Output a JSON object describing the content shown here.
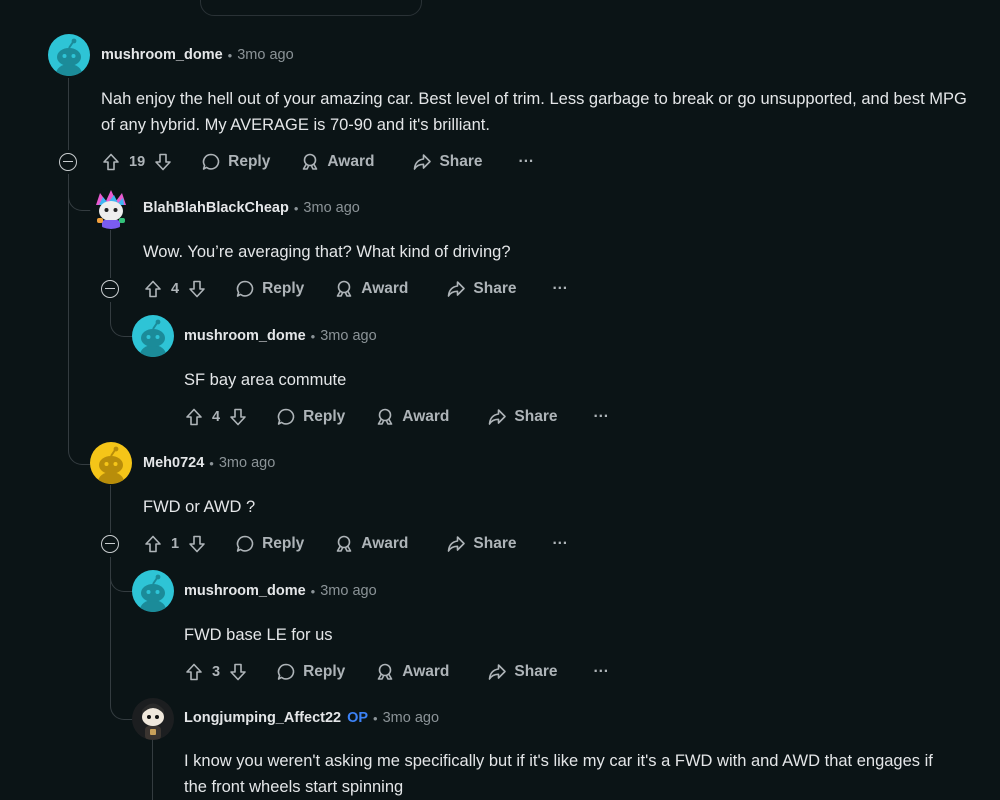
{
  "labels": {
    "reply": "Reply",
    "award": "Award",
    "share": "Share",
    "more": "···",
    "op_badge": "OP"
  },
  "colors": {
    "background": "#0b1416",
    "op_badge": "#3c82f6",
    "avatar_teal": "#2ec4d6",
    "avatar_yellow": "#f5c518"
  },
  "comments": [
    {
      "author": "mushroom_dome",
      "time": "3mo ago",
      "score": "19",
      "body": "Nah enjoy the hell out of your amazing car. Best level of trim. Less garbage to break or go unsupported, and best MPG of any hybrid. My AVERAGE is 70-90 and it's brilliant.",
      "avatar": "teal-snoo-avatar"
    },
    {
      "author": "BlahBlahBlackCheap",
      "time": "3mo ago",
      "score": "4",
      "body": "Wow. You’re averaging that? What kind of driving?",
      "avatar": "colorful-snoo-avatar"
    },
    {
      "author": "mushroom_dome",
      "time": "3mo ago",
      "score": "4",
      "body": "SF bay area commute",
      "avatar": "teal-snoo-avatar"
    },
    {
      "author": "Meh0724",
      "time": "3mo ago",
      "score": "1",
      "body": "FWD or AWD ?",
      "avatar": "yellow-snoo-avatar"
    },
    {
      "author": "mushroom_dome",
      "time": "3mo ago",
      "score": "3",
      "body": "FWD base LE for us",
      "avatar": "teal-snoo-avatar"
    },
    {
      "author": "Longjumping_Affect22",
      "time": "3mo ago",
      "is_op": true,
      "body": "I know you weren't asking me specifically but if it's like my car it's a FWD with and AWD that engages if the front wheels start spinning",
      "avatar": "dark-snoo-avatar"
    }
  ]
}
